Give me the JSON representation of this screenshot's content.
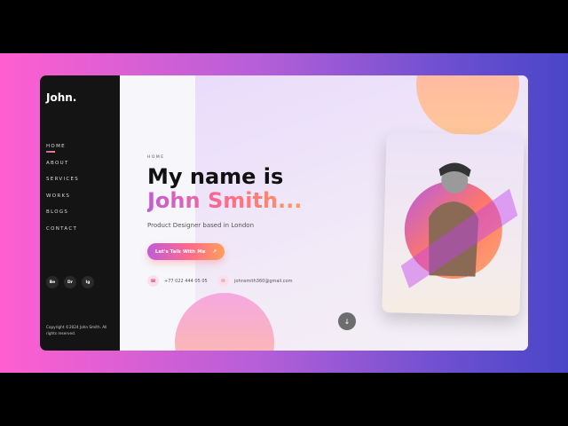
{
  "sidebar": {
    "logo": "John.",
    "nav": [
      "HOME",
      "ABOUT",
      "SERVICES",
      "WORKS",
      "BLOGS",
      "CONTACT"
    ],
    "social": [
      "Be",
      "Dr",
      "Ig"
    ],
    "copyright": "Copyright ©2024 John Smith. All rights reserved."
  },
  "hero": {
    "eyebrow": "HOME",
    "title_line1": "My name is",
    "title_line2": "John Smith...",
    "subtitle": "Product Designer based in London",
    "cta": "Let's Talk With Me",
    "cta_icon": "↗",
    "phone": "+77 022 444 05 05",
    "email": "johnsmith360@gmail.com",
    "phone_icon": "☎",
    "email_icon": "✉"
  },
  "scroll_icon": "↓"
}
